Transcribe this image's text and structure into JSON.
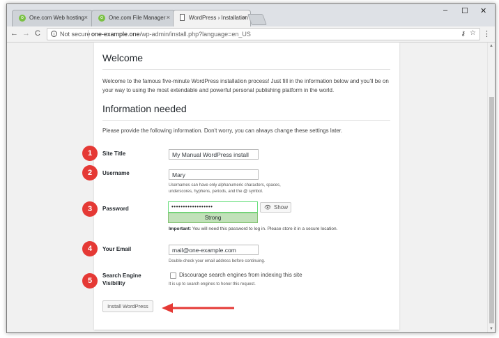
{
  "browser": {
    "tabs": [
      {
        "label": "One.com Web hosting",
        "close": "×"
      },
      {
        "label": "One.com File Manager",
        "close": "×"
      },
      {
        "label": "WordPress › Installation",
        "close": "×"
      }
    ],
    "window_controls": {
      "minimize": "–",
      "maximize": "☐",
      "close": "✕"
    },
    "nav": {
      "back": "←",
      "forward": "→",
      "reload": "C"
    },
    "address": {
      "security": "Not secure",
      "host": "one-example.one",
      "path": "/wp-admin/install.php?language=en_US"
    }
  },
  "page": {
    "welcome_title": "Welcome",
    "welcome_text": "Welcome to the famous five-minute WordPress installation process! Just fill in the information below and you'll be on your way to using the most extendable and powerful personal publishing platform in the world.",
    "info_title": "Information needed",
    "info_text": "Please provide the following information. Don't worry, you can always change these settings later.",
    "site_title": {
      "label": "Site Title",
      "value": "My Manual WordPress install"
    },
    "username": {
      "label": "Username",
      "value": "Mary",
      "hint": "Usernames can have only alphanumeric characters, spaces, underscores, hyphens, periods, and the @ symbol."
    },
    "password": {
      "label": "Password",
      "value": "••••••••••••••••••",
      "strength": "Strong",
      "show_label": "Show",
      "important_label": "Important:",
      "important_text": " You will need this password to log in. Please store it in a secure location."
    },
    "email": {
      "label": "Your Email",
      "value": "mail@one-example.com",
      "hint": "Double-check your email address before continuing."
    },
    "search_engine": {
      "label_line1": "Search Engine",
      "label_line2": "Visibility",
      "checkbox_label": "Discourage search engines from indexing this site",
      "checked": false,
      "hint": "It is up to search engines to honor this request."
    },
    "install_button": "Install WordPress"
  },
  "annotations": {
    "badges": [
      "1",
      "2",
      "3",
      "4",
      "5"
    ],
    "badge_color": "#e53935",
    "arrow_color": "#e53935"
  },
  "colors": {
    "strength_bg": "#c1e1b9",
    "strength_border": "#83c373",
    "password_border": "#68de7c"
  }
}
